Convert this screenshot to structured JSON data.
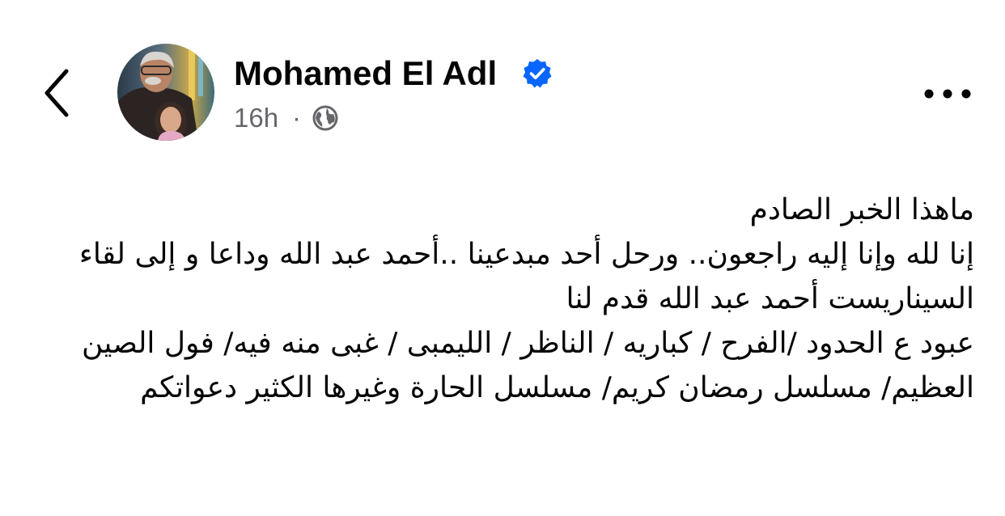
{
  "header": {
    "back_icon": "chevron-left-icon",
    "author_name": "Mohamed El Adl",
    "verified_icon": "verified-badge-icon",
    "time": "16h",
    "separator": "·",
    "audience_icon": "globe-icon",
    "more_icon": "more-horizontal-icon",
    "verified_color": "#0866ff"
  },
  "post": {
    "lines": [
      "ماهذا الخبر الصادم",
      "إنا لله وإنا إليه راجعون.. ورحل أحد مبدعينا ..أحمد عبد الله وداعا و إلى لقاء",
      "السيناريست أحمد عبد الله قدم لنا",
      "عبود ع الحدود /الفرح / كباريه / الناظر / الليمبى / غبى منه فيه/ فول الصين العظيم/ مسلسل رمضان كريم/ مسلسل الحارة وغيرها الكثير دعواتكم"
    ]
  }
}
